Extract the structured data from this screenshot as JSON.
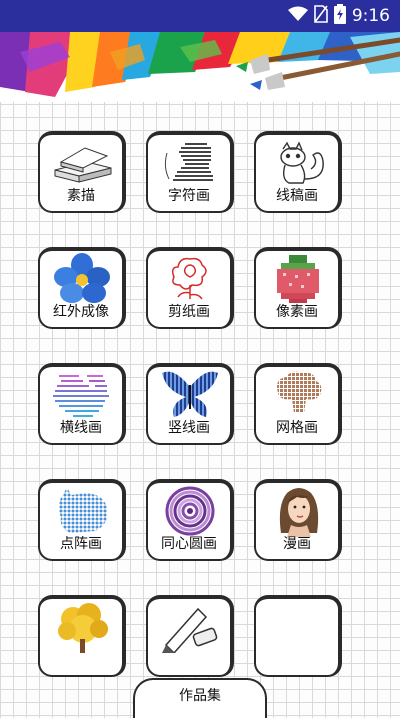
{
  "status": {
    "time": "9:16"
  },
  "tiles": [
    {
      "label": "素描"
    },
    {
      "label": "字符画"
    },
    {
      "label": "线稿画"
    },
    {
      "label": "红外成像"
    },
    {
      "label": "剪纸画"
    },
    {
      "label": "像素画"
    },
    {
      "label": "横线画"
    },
    {
      "label": "竖线画"
    },
    {
      "label": "网格画"
    },
    {
      "label": "点阵画"
    },
    {
      "label": "同心圆画"
    },
    {
      "label": "漫画"
    },
    {
      "label": ""
    },
    {
      "label": ""
    },
    {
      "label": ""
    }
  ],
  "bottom": {
    "gallery_label": "作品集"
  }
}
